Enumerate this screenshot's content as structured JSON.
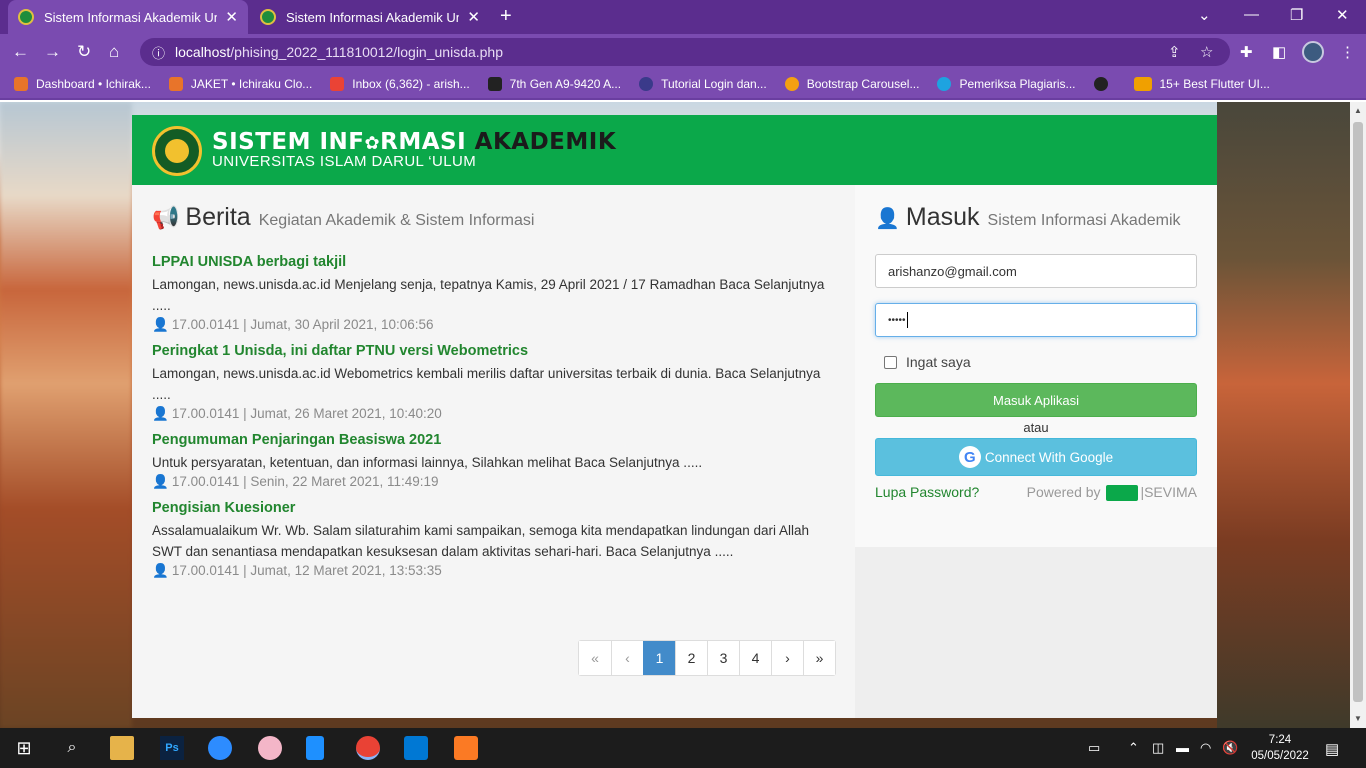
{
  "browser": {
    "tabs": [
      {
        "title": "Sistem Informasi Akademik Unive"
      },
      {
        "title": "Sistem Informasi Akademik Unive"
      }
    ],
    "url_host": "localhost",
    "url_path": "/phising_2022_111810012/login_unisda.php",
    "bookmarks": [
      {
        "label": "Dashboard • Ichirak...",
        "color": "#e8742a"
      },
      {
        "label": "JAKET • Ichiraku Clo...",
        "color": "#e8742a"
      },
      {
        "label": "Inbox (6,362) - arish...",
        "color": "#ea4335"
      },
      {
        "label": "7th Gen A9-9420 A...",
        "color": "#222222"
      },
      {
        "label": "Tutorial Login dan...",
        "color": "#3a3a8a"
      },
      {
        "label": "Bootstrap Carousel...",
        "color": "#f4a012"
      },
      {
        "label": "Pemeriksa Plagiaris...",
        "color": "#1ea3e0"
      },
      {
        "label": "15+ Best Flutter UI...",
        "color": "#f0a000"
      }
    ]
  },
  "page": {
    "brand": {
      "title_a": "SISTEM INF",
      "title_b": "RMASI",
      "title_c": "AKADEMIK",
      "subtitle": "UNIVERSITAS ISLAM DARUL ‘ULUM"
    },
    "news": {
      "heading": "Berita",
      "subheading": "Kegiatan Akademik & Sistem Informasi",
      "items": [
        {
          "title": "LPPAI UNISDA berbagi takjil",
          "desc": "Lamongan, news.unisda.ac.id  Menjelang senja, tepatnya Kamis, 29 April 2021 / 17 Ramadhan  Baca Selanjutnya .....",
          "meta": "17.00.0141 | Jumat, 30 April 2021, 10:06:56"
        },
        {
          "title": "Peringkat 1 Unisda, ini daftar PTNU versi Webometrics",
          "desc": "Lamongan, news.unisda.ac.id Webometrics kembali merilis daftar universitas terbaik di dunia. Baca Selanjutnya .....",
          "meta": "17.00.0141 | Jumat, 26 Maret 2021, 10:40:20"
        },
        {
          "title": "Pengumuman Penjaringan Beasiswa 2021",
          "desc": "Untuk persyaratan, ketentuan, dan informasi lainnya, Silahkan melihat Baca Selanjutnya .....",
          "meta": "17.00.0141 | Senin, 22 Maret 2021, 11:49:19"
        },
        {
          "title": "Pengisian Kuesioner",
          "desc": "Assalamualaikum Wr. Wb. Salam silaturahim kami sampaikan, semoga kita mendapatkan lindungan dari Allah SWT dan senantiasa mendapatkan kesuksesan dalam aktivitas sehari-hari. Baca Selanjutnya .....",
          "meta": "17.00.0141 | Jumat, 12 Maret 2021, 13:53:35"
        }
      ],
      "pagination": {
        "first": "«",
        "prev": "‹",
        "pages": [
          "1",
          "2",
          "3",
          "4"
        ],
        "next": "›",
        "last": "»",
        "active": "1"
      }
    },
    "login": {
      "heading": "Masuk",
      "subheading": "Sistem Informasi Akademik",
      "email_value": "arishanzo@gmail.com",
      "password_value": "•••••",
      "remember_label": "Ingat saya",
      "submit_label": "Masuk Aplikasi",
      "or_label": "atau",
      "google_label": "Connect With Google",
      "forgot_label": "Lupa Password?",
      "powered_prefix": "Powered by",
      "powered_brand": "SEVIMA"
    }
  },
  "taskbar": {
    "time": "7:24",
    "date": "05/05/2022"
  }
}
